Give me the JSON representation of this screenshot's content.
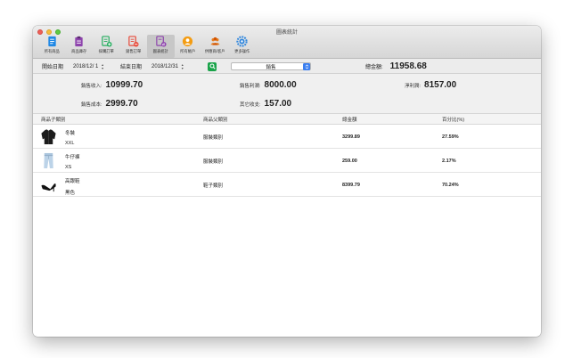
{
  "window": {
    "title": "圖表統計"
  },
  "toolbar": {
    "items": [
      {
        "label": "所有商品",
        "icon": "document-icon",
        "color": "#1f88e5"
      },
      {
        "label": "商品庫存",
        "icon": "clipboard-icon",
        "color": "#8e44ad"
      },
      {
        "label": "採購訂單",
        "icon": "purchase-order-icon",
        "color": "#27ae60"
      },
      {
        "label": "銷售訂單",
        "icon": "sales-order-icon",
        "color": "#e74c3c"
      },
      {
        "label": "圖表統計",
        "icon": "report-icon",
        "color": "#8e44ad",
        "active": true
      },
      {
        "label": "所有帳戶",
        "icon": "user-icon",
        "color": "#f39c12"
      },
      {
        "label": "供應商/客戶",
        "icon": "group-icon",
        "color": "#e67e22"
      },
      {
        "label": "更多操作",
        "icon": "gear-icon",
        "color": "#2e86de"
      }
    ]
  },
  "filter": {
    "start_label": "開始日期",
    "start_value": "2018/12/ 1",
    "end_label": "結束日期",
    "end_value": "2018/12/31",
    "type_value": "銷售",
    "total_label": "總金額:",
    "total_value": "11958.68"
  },
  "stats": {
    "sales_income_label": "銷售收入:",
    "sales_income_value": "10999.70",
    "sales_profit_label": "銷售利潤:",
    "sales_profit_value": "8000.00",
    "net_profit_label": "淨利潤:",
    "net_profit_value": "8157.00",
    "sales_cost_label": "銷售成本:",
    "sales_cost_value": "2999.70",
    "other_income_label": "其它收支:",
    "other_income_value": "157.00"
  },
  "table": {
    "headers": [
      "商品子類別",
      "商品父類別",
      "總金額",
      "百分比(%)"
    ],
    "rows": [
      {
        "name": "冬裝",
        "variant": "XXL",
        "category": "服裝類別",
        "amount": "3299.89",
        "percent": "27.59%",
        "thumb": "jacket-thumbnail"
      },
      {
        "name": "牛仔褲",
        "variant": "XS",
        "category": "服裝類別",
        "amount": "259.00",
        "percent": "2.17%",
        "thumb": "jeans-thumbnail"
      },
      {
        "name": "高跟鞋",
        "variant": "黑色",
        "category": "鞋子類別",
        "amount": "8399.79",
        "percent": "70.24%",
        "thumb": "high-heel-thumbnail"
      }
    ]
  }
}
